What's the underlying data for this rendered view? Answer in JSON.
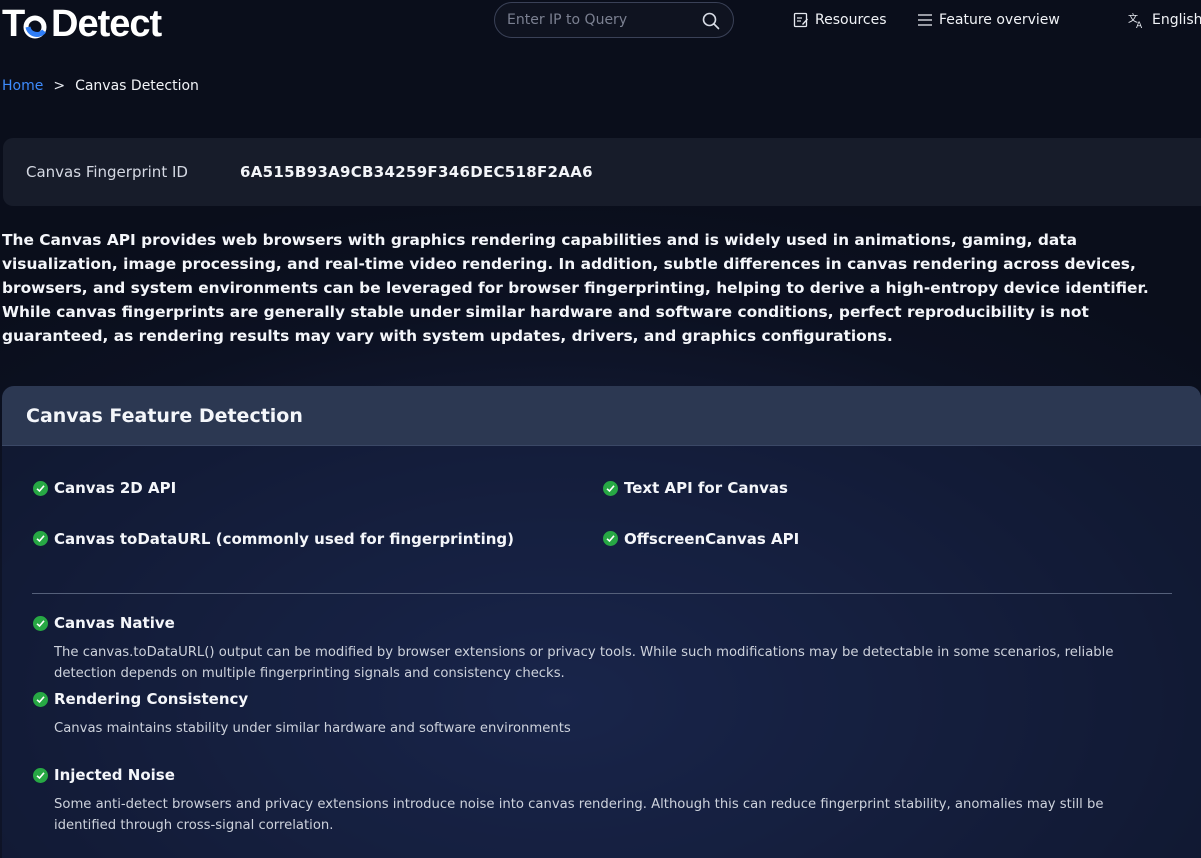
{
  "header": {
    "logo_text": "To Detect",
    "search_placeholder": "Enter IP to Query",
    "nav": {
      "resources": "Resources",
      "feature_overview": "Feature overview",
      "language": "English"
    }
  },
  "breadcrumb": {
    "home": "Home",
    "separator": ">",
    "current": "Canvas Detection"
  },
  "fingerprint": {
    "label": "Canvas Fingerprint ID",
    "value": "6A515B93A9CB34259F346DEC518F2AA6"
  },
  "description": "The Canvas API provides web browsers with graphics rendering capabilities and is widely used in animations, gaming, data visualization, image processing, and real-time video rendering. In addition, subtle differences in canvas rendering across devices, browsers, and system environments can be leveraged for browser fingerprinting, helping to derive a high-entropy device identifier. While canvas fingerprints are generally stable under similar hardware and software conditions, perfect reproducibility is not guaranteed, as rendering results may vary with system updates, drivers, and graphics configurations.",
  "panel": {
    "title": "Canvas Feature Detection",
    "features": [
      "Canvas 2D API",
      "Text API for Canvas",
      "Canvas toDataURL (commonly used for fingerprinting)",
      "OffscreenCanvas API"
    ],
    "checks": [
      {
        "title": "Canvas Native",
        "description": "The canvas.toDataURL() output can be modified by browser extensions or privacy tools. While such modifications may be detectable in some scenarios, reliable detection depends on multiple fingerprinting signals and consistency checks."
      },
      {
        "title": "Rendering Consistency",
        "description": "Canvas maintains stability under similar hardware and software environments"
      },
      {
        "title": "Injected Noise",
        "description": "Some anti-detect browsers and privacy extensions introduce noise into canvas rendering. Although this can reduce fingerprint stability, anomalies may still be identified through cross-signal correlation."
      }
    ]
  },
  "colors": {
    "accent_blue": "#3d8bfd",
    "check_green": "#27a844"
  }
}
